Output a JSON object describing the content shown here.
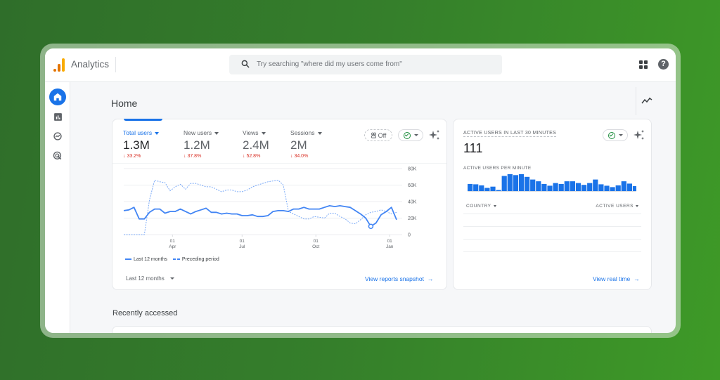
{
  "app": {
    "title": "Analytics",
    "search_placeholder": "Try searching \"where did my users come from\"",
    "icons": {
      "logo": "analytics-bars-logo",
      "search": "search-icon",
      "apps": "apps-grid-icon",
      "help": "help-icon"
    },
    "colors": {
      "background": "#357f2b",
      "accent": "#1a73e8",
      "negative": "#d93025",
      "positive": "#1e8e3e",
      "logo_orange": "#f9ab00",
      "logo_dark_orange": "#e37400"
    }
  },
  "sidenav": {
    "items": [
      {
        "name": "home",
        "icon": "home-icon",
        "active": true
      },
      {
        "name": "reports",
        "icon": "bar-chart-icon",
        "active": false
      },
      {
        "name": "explore",
        "icon": "explore-icon",
        "active": false
      },
      {
        "name": "advertising",
        "icon": "target-icon",
        "active": false
      }
    ],
    "settings_icon": "settings-icon"
  },
  "main": {
    "title": "Home",
    "insights_icon": "insights-icon",
    "overview_card": {
      "metrics": [
        {
          "label": "Total users",
          "value": "1.3M",
          "change": "33.2%",
          "direction": "down",
          "active": true
        },
        {
          "label": "New users",
          "value": "1.2M",
          "change": "37.8%",
          "direction": "down",
          "active": false
        },
        {
          "label": "Views",
          "value": "2.4M",
          "change": "52.8%",
          "direction": "down",
          "active": false
        },
        {
          "label": "Sessions",
          "value": "2M",
          "change": "34.0%",
          "direction": "down",
          "active": false
        }
      ],
      "comparison_chip": "Off",
      "legend": {
        "current": "Last 12 months",
        "previous": "Preceding period"
      },
      "date_range": "Last 12 months",
      "link": "View reports snapshot",
      "arrow": "→"
    },
    "realtime_card": {
      "title": "ACTIVE USERS IN LAST 30 MINUTES",
      "value": "111",
      "subtitle": "ACTIVE USERS PER MINUTE",
      "per_minute": [
        40,
        38,
        32,
        18,
        25,
        5,
        85,
        95,
        90,
        95,
        80,
        65,
        55,
        40,
        30,
        45,
        40,
        55,
        55,
        45,
        35,
        45,
        65,
        38,
        30,
        22,
        32,
        55,
        42,
        28
      ],
      "table_headers": {
        "country": "COUNTRY",
        "active_users": "ACTIVE USERS"
      },
      "link": "View real time",
      "arrow": "→"
    },
    "recently_accessed": "Recently accessed"
  },
  "chart_data": {
    "type": "line",
    "title": "Total users",
    "x_ticks": [
      {
        "day": "01",
        "month": "Apr"
      },
      {
        "day": "01",
        "month": "Jul"
      },
      {
        "day": "01",
        "month": "Oct"
      },
      {
        "day": "01",
        "month": "Jan"
      }
    ],
    "y_ticks": [
      "80K",
      "60K",
      "40K",
      "20K",
      "0"
    ],
    "ylim": [
      0,
      80000
    ],
    "grid": true,
    "legend_position": "bottom-left",
    "series": [
      {
        "name": "Last 12 months",
        "style": "solid",
        "values": [
          29000,
          30000,
          33000,
          19000,
          19000,
          27000,
          31000,
          31000,
          26000,
          28000,
          28000,
          31000,
          28000,
          25000,
          28000,
          30000,
          32000,
          27000,
          27000,
          25000,
          26000,
          25000,
          25000,
          23000,
          23000,
          24000,
          22000,
          22000,
          23000,
          28000,
          29000,
          29000,
          28000,
          31000,
          31000,
          33000,
          31000,
          31000,
          31000,
          33000,
          35000,
          34000,
          35000,
          34000,
          33000,
          29000,
          25000,
          20000,
          10000,
          14000,
          24000,
          28000,
          33000,
          18000
        ]
      },
      {
        "name": "Preceding period",
        "style": "dashed",
        "values": [
          0,
          0,
          0,
          0,
          0,
          42000,
          66000,
          64000,
          63000,
          53000,
          58000,
          61000,
          55000,
          62000,
          62000,
          60000,
          58000,
          58000,
          55000,
          52000,
          54000,
          54000,
          52000,
          52000,
          54000,
          58000,
          60000,
          62000,
          64000,
          65000,
          66000,
          60000,
          28000,
          25000,
          22000,
          19000,
          19000,
          22000,
          21000,
          20000,
          26000,
          26000,
          22000,
          19000,
          14000,
          13000,
          18000,
          24000,
          27000,
          28000,
          30000,
          28000,
          25000,
          27000
        ]
      }
    ]
  }
}
